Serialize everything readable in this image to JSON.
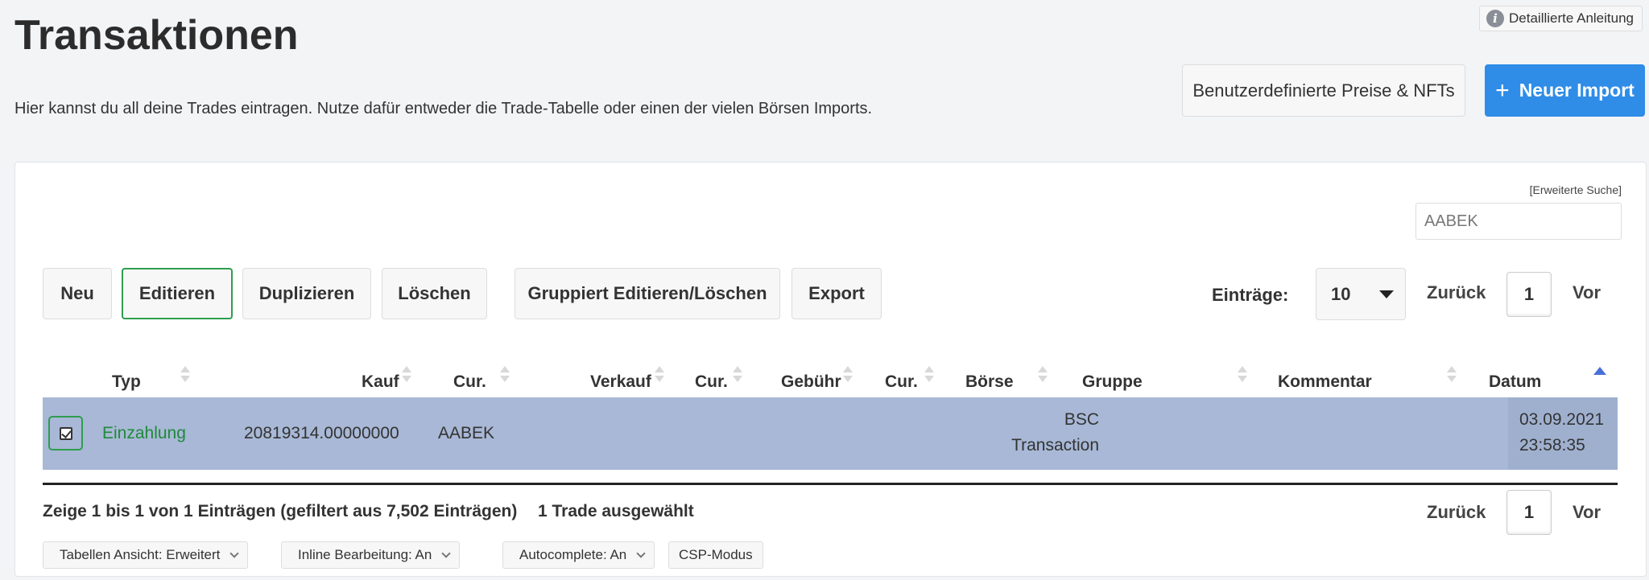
{
  "header": {
    "title": "Transaktionen",
    "subtitle": "Hier kannst du all deine Trades eintragen. Nutze dafür entweder die Trade-Tabelle oder einen der vielen Börsen Imports.",
    "help_label": "Detaillierte Anleitung",
    "custom_prices_label": "Benutzerdefinierte Preise & NFTs",
    "new_import_label": "Neuer Import"
  },
  "search": {
    "advanced_label": "[Erweiterte Suche]",
    "value": "AABEK"
  },
  "toolbar": {
    "new": "Neu",
    "edit": "Editieren",
    "duplicate": "Duplizieren",
    "delete": "Löschen",
    "group_edit": "Gruppiert Editieren/Löschen",
    "export": "Export"
  },
  "pagination": {
    "entries_label": "Einträge:",
    "entries_value": "10",
    "prev": "Zurück",
    "page": "1",
    "next": "Vor"
  },
  "table": {
    "columns": [
      "Typ",
      "Kauf",
      "Cur.",
      "Verkauf",
      "Cur.",
      "Gebühr",
      "Cur.",
      "Börse",
      "Gruppe",
      "Kommentar",
      "Datum"
    ],
    "rows": [
      {
        "type": "Einzahlung",
        "buy": "20819314.00000000",
        "buy_cur": "AABEK",
        "sell": "",
        "sell_cur": "",
        "fee": "",
        "fee_cur": "",
        "exchange_line1": "BSC",
        "exchange_line2": "Transaction",
        "group": "",
        "comment": "",
        "date": "03.09.2021",
        "time": "23:58:35"
      }
    ]
  },
  "footer": {
    "info": "Zeige 1 bis 1 von 1 Einträgen (gefiltert aus 7,502 Einträgen)",
    "selected": "1 Trade ausgewählt",
    "chips": [
      "Tabellen Ansicht: Erweitert",
      "Inline Bearbeitung: An",
      "Autocomplete: An",
      "CSP-Modus"
    ]
  },
  "colors": {
    "accent": "#2f8de7",
    "selected_row": "#a8b8d6",
    "highlight_border": "#2e9d4f",
    "deposit_text": "#1f8a3a"
  }
}
